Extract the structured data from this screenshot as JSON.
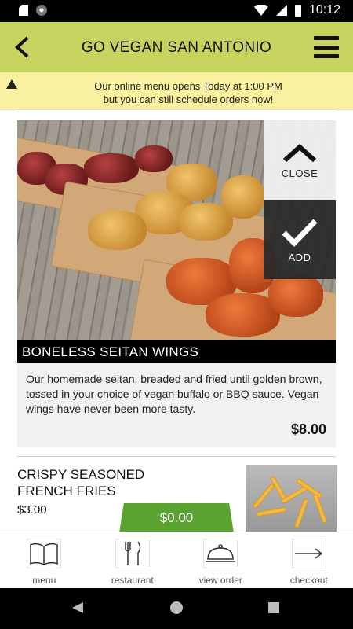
{
  "status_bar": {
    "time": "10:12",
    "icons": [
      "sd-card-icon",
      "sync-icon",
      "wifi-icon",
      "cell-signal-icon",
      "battery-icon"
    ]
  },
  "app_bar": {
    "title": "GO VEGAN SAN ANTONIO",
    "back_icon": "back-arrow-icon",
    "menu_icon": "hamburger-icon",
    "color": "#c7d35f"
  },
  "notice": {
    "icon": "warning-icon",
    "line1": "Our online menu opens Today at 1:00 PM",
    "line2": "but you can still schedule orders now!",
    "color": "#f9f19f"
  },
  "featured_item": {
    "name": "BONELESS SEITAN WINGS",
    "description": "Our homemade seitan, breaded and fried until golden brown, tossed in your choice of vegan buffalo or BBQ sauce. Vegan wings have never been more tasty.",
    "price": "$8.00",
    "close_label": "CLOSE",
    "add_label": "ADD"
  },
  "next_item": {
    "name": "CRISPY SEASONED FRENCH FRIES",
    "price": "$3.00"
  },
  "cart": {
    "total": "$0.00",
    "color": "#5aa330"
  },
  "bottom_nav": [
    {
      "label": "menu",
      "icon": "book-icon"
    },
    {
      "label": "restaurant",
      "icon": "fork-knife-icon"
    },
    {
      "label": "view order",
      "icon": "cloche-icon"
    },
    {
      "label": "checkout",
      "icon": "arrow-right-icon"
    }
  ]
}
